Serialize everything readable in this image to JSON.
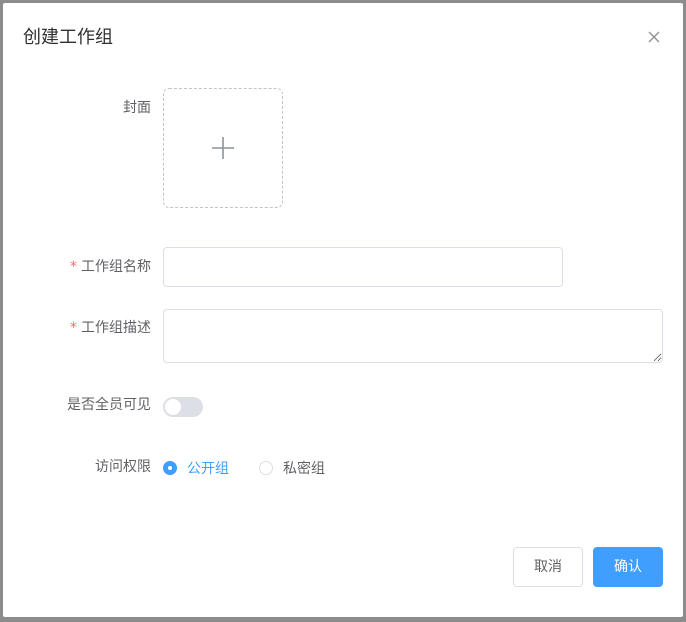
{
  "dialog": {
    "title": "创建工作组",
    "close_icon": "close-icon"
  },
  "form": {
    "cover": {
      "label": "封面",
      "icon": "plus-icon"
    },
    "name": {
      "label": "工作组名称",
      "required_mark": "*",
      "value": ""
    },
    "description": {
      "label": "工作组描述",
      "required_mark": "*",
      "value": ""
    },
    "visible_to_all": {
      "label": "是否全员可见",
      "enabled": false
    },
    "access": {
      "label": "访问权限",
      "options": [
        {
          "label": "公开组",
          "checked": true
        },
        {
          "label": "私密组",
          "checked": false
        }
      ]
    }
  },
  "footer": {
    "cancel_label": "取消",
    "confirm_label": "确认"
  },
  "colors": {
    "primary": "#409eff",
    "required": "#f56c6c",
    "text": "#606266",
    "title": "#303133",
    "border": "#dcdfe6"
  }
}
